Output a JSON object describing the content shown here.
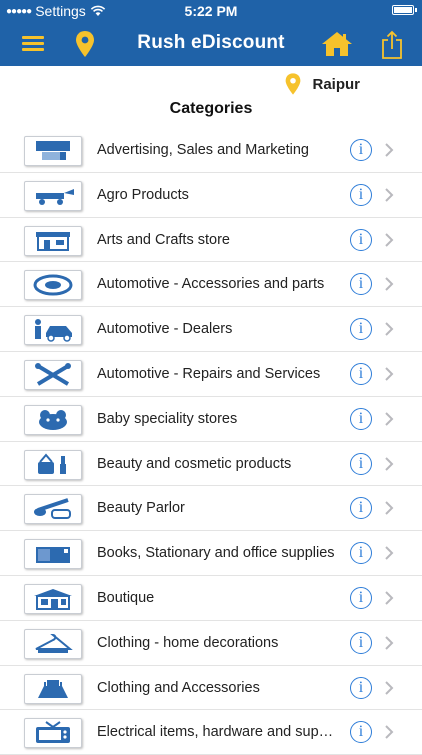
{
  "status": {
    "carrier": "Settings",
    "time": "5:22 PM"
  },
  "nav": {
    "title": "Rush eDiscount"
  },
  "location": {
    "city": "Raipur"
  },
  "page": {
    "title": "Categories"
  },
  "colors": {
    "bar": "#1f62a8",
    "accent": "#f6c22c",
    "info": "#2e7dd8",
    "icon": "#2c6ab0"
  },
  "icons": {
    "menu": "hamburger-icon",
    "location": "location-pin-icon",
    "home": "home-icon",
    "share": "share-icon",
    "info": "info-icon",
    "chevron": "chevron-right-icon"
  },
  "categories": [
    {
      "label": "Advertising, Sales and Marketing",
      "icon": "billboard-icon"
    },
    {
      "label": "Agro Products",
      "icon": "tractor-icon"
    },
    {
      "label": "Arts and Crafts store",
      "icon": "storefront-icon"
    },
    {
      "label": "Automotive - Accessories and parts",
      "icon": "tire-icon"
    },
    {
      "label": "Automotive - Dealers",
      "icon": "car-dealer-icon"
    },
    {
      "label": "Automotive - Repairs and Services",
      "icon": "wrench-icon"
    },
    {
      "label": "Baby speciality stores",
      "icon": "teddy-bear-icon"
    },
    {
      "label": "Beauty and cosmetic products",
      "icon": "cosmetics-icon"
    },
    {
      "label": "Beauty Parlor",
      "icon": "makeup-brush-icon"
    },
    {
      "label": "Books, Stationary and office supplies",
      "icon": "books-icon"
    },
    {
      "label": "Boutique",
      "icon": "boutique-icon"
    },
    {
      "label": "Clothing - home decorations",
      "icon": "hanger-icon"
    },
    {
      "label": "Clothing and Accessories",
      "icon": "dress-icon"
    },
    {
      "label": "Electrical items, hardware and supplies",
      "icon": "tv-icon"
    }
  ]
}
